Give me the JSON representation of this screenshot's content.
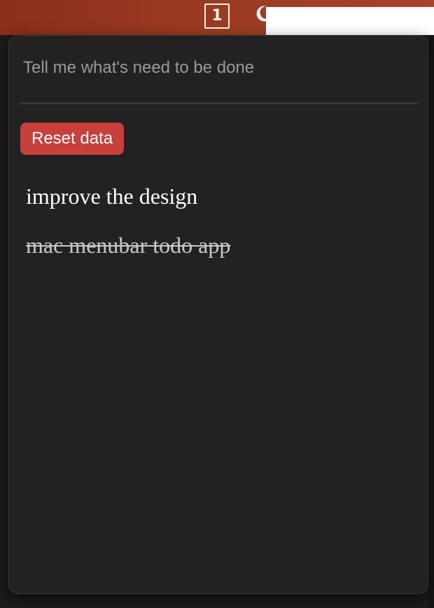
{
  "menubar": {
    "tray_count": "1",
    "moon_icon": "moon-icon"
  },
  "popover": {
    "input_placeholder": "Tell me what's need to be done",
    "input_value": "",
    "reset_label": "Reset data",
    "todos": [
      {
        "text": "improve the design",
        "done": false
      },
      {
        "text": "mac menubar todo app",
        "done": true
      }
    ]
  },
  "colors": {
    "menubar_start": "#8a2e1a",
    "menubar_end": "#a6442a",
    "popover_bg": "#222222",
    "reset_button": "#c8403c",
    "todo_text": "#ffffff",
    "todo_done_text": "#c9c9c9"
  }
}
